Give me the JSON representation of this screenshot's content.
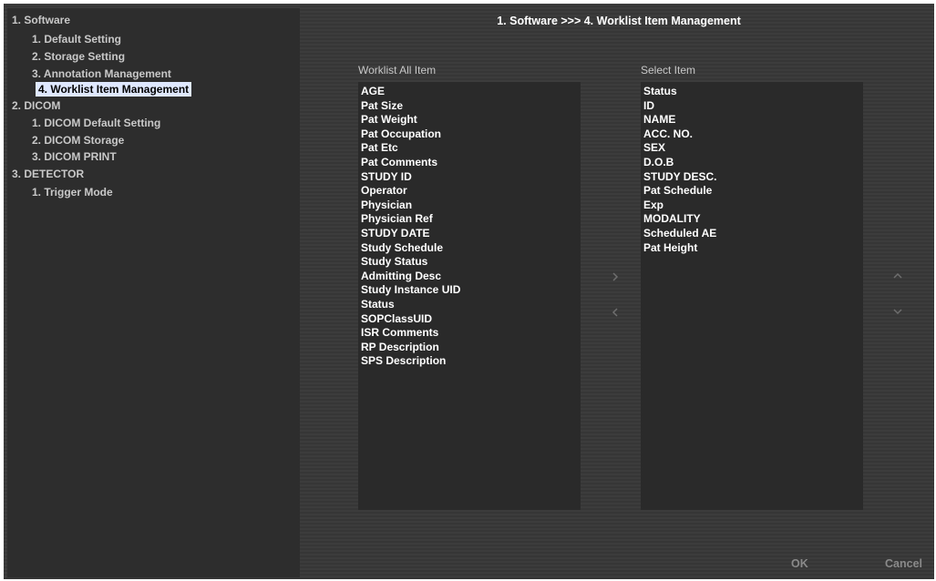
{
  "nav": {
    "items": [
      {
        "label": "1. Software"
      },
      {
        "label": "1. Default Setting"
      },
      {
        "label": "2. Storage Setting"
      },
      {
        "label": "3. Annotation Management"
      },
      {
        "label": "4. Worklist Item Management"
      },
      {
        "label": "2. DICOM"
      },
      {
        "label": "1. DICOM Default Setting"
      },
      {
        "label": "2. DICOM Storage"
      },
      {
        "label": "3. DICOM PRINT"
      },
      {
        "label": "3. DETECTOR"
      },
      {
        "label": "1. Trigger Mode"
      }
    ]
  },
  "header": {
    "breadcrumb": "1. Software >>> 4. Worklist Item Management"
  },
  "all_items": {
    "title": "Worklist All Item",
    "items": [
      "AGE",
      "Pat Size",
      "Pat Weight",
      "Pat Occupation",
      "Pat Etc",
      "Pat Comments",
      "STUDY ID",
      "Operator",
      "Physician",
      "Physician Ref",
      "STUDY DATE",
      "Study Schedule",
      "Study Status",
      "Admitting Desc",
      "Study Instance UID",
      "Status",
      "SOPClassUID",
      "ISR Comments",
      "RP Description",
      "SPS Description"
    ]
  },
  "selected_items": {
    "title": "Select Item",
    "items": [
      "Status",
      "ID",
      "NAME",
      "ACC. NO.",
      "SEX",
      "D.O.B",
      "STUDY DESC.",
      "Pat Schedule",
      "Exp",
      "MODALITY",
      "Scheduled AE",
      "Pat Height"
    ]
  },
  "icons": {
    "add": "chevron-right-icon",
    "remove": "chevron-left-icon",
    "move_up": "chevron-up-icon",
    "move_down": "chevron-down-icon"
  },
  "buttons": {
    "ok": "OK",
    "cancel": "Cancel"
  },
  "colors": {
    "selected_bg": "#dfe8ff",
    "panel_bg": "#2d2d2d",
    "list_bg": "#2a2a2a"
  }
}
